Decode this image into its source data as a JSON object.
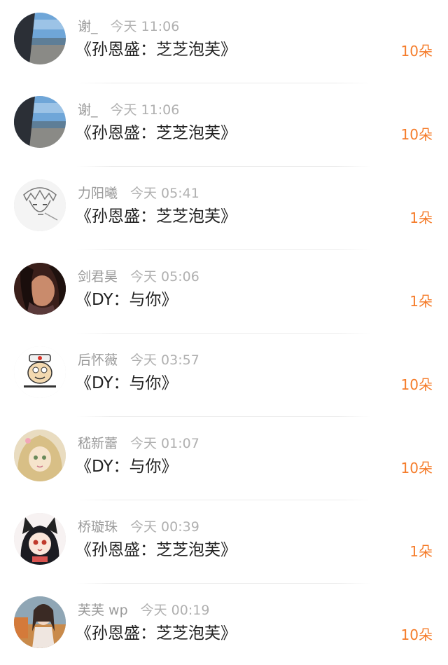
{
  "items": [
    {
      "name": "谢_",
      "time": "今天 11:06",
      "message": "《孙恩盛：芝芝泡芙》",
      "count": "10朵",
      "avatar": "beach-avatar-icon"
    },
    {
      "name": "谢_",
      "time": "今天 11:06",
      "message": "《孙恩盛：芝芝泡芙》",
      "count": "10朵",
      "avatar": "beach-avatar-icon"
    },
    {
      "name": "力阳曦",
      "time": "今天 05:41",
      "message": "《孙恩盛：芝芝泡芙》",
      "count": "1朵",
      "avatar": "sketch-anime-avatar-icon"
    },
    {
      "name": "剑君昊",
      "time": "今天 05:06",
      "message": "《DY：与你》",
      "count": "1朵",
      "avatar": "girl-photo-avatar-icon"
    },
    {
      "name": "后怀薇",
      "time": "今天 03:57",
      "message": "《DY：与你》",
      "count": "10朵",
      "avatar": "cartoon-face-avatar-icon"
    },
    {
      "name": "嵇新蕾",
      "time": "今天 01:07",
      "message": "《DY：与你》",
      "count": "10朵",
      "avatar": "anime-blonde-avatar-icon"
    },
    {
      "name": "桥璇珠",
      "time": "今天 00:39",
      "message": "《孙恩盛：芝芝泡芙》",
      "count": "1朵",
      "avatar": "anime-catgirl-avatar-icon"
    },
    {
      "name": "芙芙 wp",
      "time": "今天 00:19",
      "message": "《孙恩盛：芝芝泡芙》",
      "count": "10朵",
      "avatar": "woman-photo-avatar-icon"
    }
  ]
}
